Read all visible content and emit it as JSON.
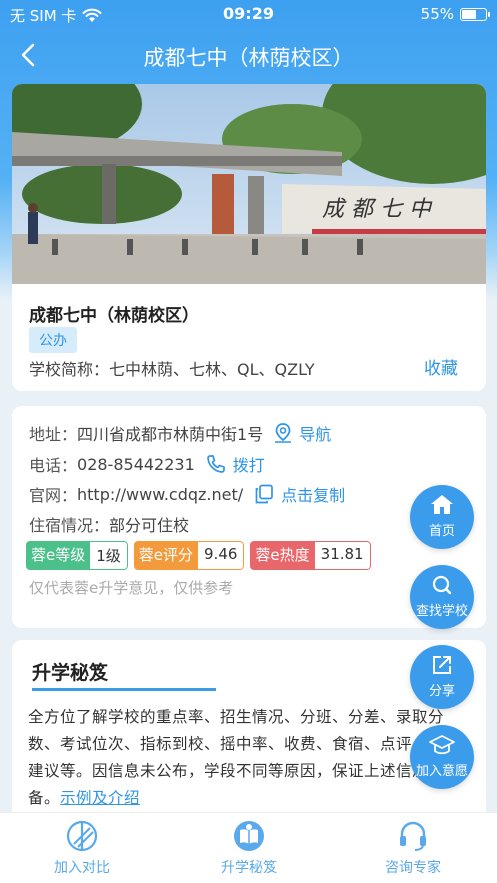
{
  "status_bar": {
    "carrier": "无 SIM 卡",
    "time": "09:29",
    "battery": "55%"
  },
  "nav": {
    "title": "成都七中（林荫校区）"
  },
  "school": {
    "name": "成都七中（林荫校区）",
    "type_tag": "公办",
    "abbr": "学校简称：七中林荫、七林、QL、QZLY",
    "collect_label": "收藏"
  },
  "info": {
    "address_label": "地址：",
    "address": "四川省成都市林荫中街1号",
    "navigate_label": "导航",
    "phone_label": "电话：",
    "phone": "028-85442231",
    "call_label": "拨打",
    "website_label": "官网：",
    "website": "http://www.cdqz.net/",
    "copy_label": "点击复制",
    "boarding_label": "住宿情况：",
    "boarding": "部分可住校",
    "ratings": [
      {
        "key": "蓉e等级",
        "value": "1级",
        "color": "#4cc08a"
      },
      {
        "key": "蓉e评分",
        "value": "9.46",
        "color": "#f39a3c"
      },
      {
        "key": "蓉e热度",
        "value": "31.81",
        "color": "#e8676b"
      }
    ],
    "disclaimer": "仅代表蓉e升学意见，仅供参考"
  },
  "guide": {
    "title": "升学秘笈",
    "body": "全方位了解学校的重点率、招生情况、分班、分差、录取分数、考试位次、指标到校、摇中率、收费、食宿、点评、就读建议等。因信息未公布，学段不同等原因，保证上述信息都齐备。",
    "link": "示例及介绍"
  },
  "fabs": {
    "home": "首页",
    "find": "查找学校",
    "share": "分享",
    "wish": "加入意愿"
  },
  "tabs": {
    "compare": "加入对比",
    "guide": "升学秘笈",
    "expert": "咨询专家"
  },
  "colors": {
    "primary": "#3c9cec",
    "accent_text": "#2f95e6"
  }
}
